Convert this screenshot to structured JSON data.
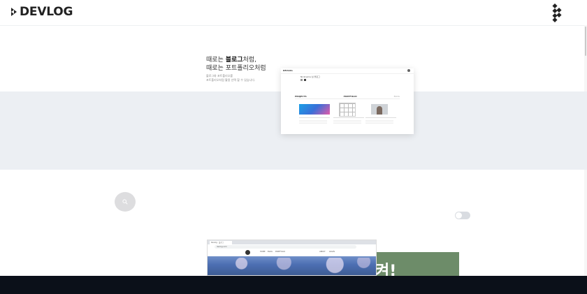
{
  "header": {
    "brand": "DEVLOG"
  },
  "hero": {
    "line1_pre": "때로는 ",
    "line1_bold": "블로그",
    "line1_post": "처럼,",
    "line2": "때로는 포트폴리오처럼",
    "sub1": "블로그와 포트폴리오를",
    "sub2": "포트폴리오처럼 활용 선택 할 수 있습니다."
  },
  "preview": {
    "brand": "DEVLOG",
    "profile": "Nickname 님 블로그",
    "tabs": [
      "PROJECTS",
      "PORTFOLIO",
      "BLOG"
    ]
  },
  "browser_mock": {
    "tab_title": "Devlog · 블로그",
    "url": "devlog.com",
    "nav_items": [
      "HOME",
      "BLOG",
      "PORTFOLIO",
      "ABOUT",
      "LOGIN"
    ]
  },
  "green_panel": {
    "text": "켜!"
  },
  "toggle": {
    "on": false
  },
  "colors": {
    "band": "#eceff3",
    "bottom_bar": "#0b1019",
    "green": "#6d8c69",
    "search_circle": "#dddddf"
  }
}
